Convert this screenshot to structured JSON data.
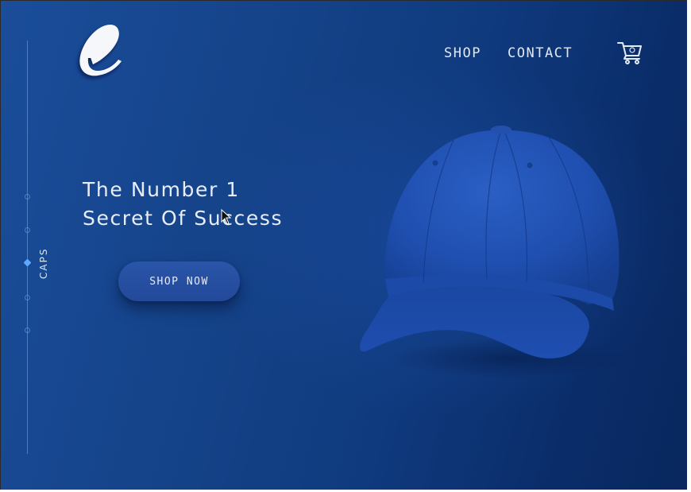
{
  "colors": {
    "background_start": "#1a4d9a",
    "background_end": "#08275e",
    "accent": "#5fa8ff",
    "cap_blue": "#1f4fb0",
    "text": "#e8eef9"
  },
  "brand": {
    "logo_letter": "e",
    "logo_icon": "script-e-logo"
  },
  "nav": {
    "shop_label": "SHOP",
    "contact_label": "CONTACT",
    "cart_icon": "shopping-cart-icon"
  },
  "side_rail": {
    "category_label": "CAPS",
    "active_index": 2,
    "dot_count": 5
  },
  "hero": {
    "headline_line1": "The Number 1",
    "headline_line2": "Secret Of Success",
    "cta_label": "SHOP NOW",
    "product_image": "blue-baseball-cap"
  }
}
